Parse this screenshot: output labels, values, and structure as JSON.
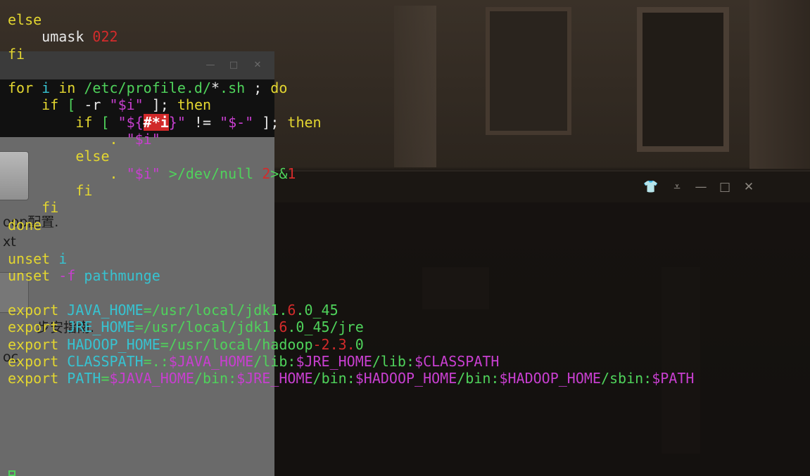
{
  "background_terminal": {
    "controls": {
      "shirt_glyph": "👕",
      "dropdown_glyph": "⩡",
      "minimize_glyph": "—",
      "maximize_glyph": "□",
      "close_glyph": "✕"
    }
  },
  "left_window": {
    "controls": {
      "minimize_glyph": "—",
      "maximize_glyph": "□",
      "close_glyph": "✕"
    },
    "texts": [
      "oop配置.",
      "xt",
      "步安指南.",
      "oc"
    ]
  },
  "terminal": {
    "colors": {
      "keyword": "#e3d630",
      "string": "#4fd35b",
      "variable": "#37c3d1",
      "special": "#c83fd0",
      "number": "#d32b2b"
    },
    "lines": [
      [
        {
          "t": "else",
          "c": "y"
        }
      ],
      [
        {
          "t": "    umask ",
          "c": "w"
        },
        {
          "t": "022",
          "c": "r"
        }
      ],
      [
        {
          "t": "fi",
          "c": "y"
        }
      ],
      [
        {
          "t": "",
          "c": "w"
        }
      ],
      [
        {
          "t": "for",
          "c": "y"
        },
        {
          "t": " i ",
          "c": "c"
        },
        {
          "t": "in",
          "c": "y"
        },
        {
          "t": " /etc/profile.d/",
          "c": "g"
        },
        {
          "t": "*",
          "c": "w"
        },
        {
          "t": ".sh",
          "c": "g"
        },
        {
          "t": " ; ",
          "c": "w"
        },
        {
          "t": "do",
          "c": "y"
        }
      ],
      [
        {
          "t": "    if",
          "c": "y"
        },
        {
          "t": " [ ",
          "c": "g"
        },
        {
          "t": "-r",
          "c": "w"
        },
        {
          "t": " \"",
          "c": "m"
        },
        {
          "t": "$i",
          "c": "m"
        },
        {
          "t": "\"",
          "c": "m"
        },
        {
          "t": " ]; ",
          "c": "w"
        },
        {
          "t": "then",
          "c": "y"
        }
      ],
      [
        {
          "t": "        if",
          "c": "y"
        },
        {
          "t": " [ ",
          "c": "g"
        },
        {
          "t": "\"${",
          "c": "m"
        },
        {
          "t": "#*i",
          "c": "hl"
        },
        {
          "t": "}\"",
          "c": "m"
        },
        {
          "t": " != ",
          "c": "w"
        },
        {
          "t": "\"$-\"",
          "c": "m"
        },
        {
          "t": " ]; ",
          "c": "w"
        },
        {
          "t": "then",
          "c": "y"
        }
      ],
      [
        {
          "t": "            . ",
          "c": "y"
        },
        {
          "t": "\"$i\"",
          "c": "m"
        }
      ],
      [
        {
          "t": "        else",
          "c": "y"
        }
      ],
      [
        {
          "t": "            . ",
          "c": "y"
        },
        {
          "t": "\"$i\"",
          "c": "m"
        },
        {
          "t": " >/dev/null ",
          "c": "g"
        },
        {
          "t": "2",
          "c": "r"
        },
        {
          "t": ">&",
          "c": "g"
        },
        {
          "t": "1",
          "c": "r"
        }
      ],
      [
        {
          "t": "        fi",
          "c": "y"
        }
      ],
      [
        {
          "t": "    fi",
          "c": "y"
        }
      ],
      [
        {
          "t": "done",
          "c": "y"
        }
      ],
      [
        {
          "t": "",
          "c": "w"
        }
      ],
      [
        {
          "t": "unset",
          "c": "y"
        },
        {
          "t": " i",
          "c": "c"
        }
      ],
      [
        {
          "t": "unset",
          "c": "y"
        },
        {
          "t": " -f",
          "c": "m"
        },
        {
          "t": " pathmunge",
          "c": "c"
        }
      ],
      [
        {
          "t": "",
          "c": "w"
        }
      ],
      [
        {
          "t": "export",
          "c": "y"
        },
        {
          "t": " JAVA_HOME",
          "c": "c"
        },
        {
          "t": "=/usr/local/jdk1.",
          "c": "g"
        },
        {
          "t": "6",
          "c": "r"
        },
        {
          "t": ".0_45",
          "c": "g"
        }
      ],
      [
        {
          "t": "export",
          "c": "y"
        },
        {
          "t": " JRE_HOME",
          "c": "c"
        },
        {
          "t": "=/usr/local/jdk1.",
          "c": "g"
        },
        {
          "t": "6",
          "c": "r"
        },
        {
          "t": ".0_45/jre",
          "c": "g"
        }
      ],
      [
        {
          "t": "export",
          "c": "y"
        },
        {
          "t": " HADOOP_HOME",
          "c": "c"
        },
        {
          "t": "=/usr/local/hadoop",
          "c": "g"
        },
        {
          "t": "-2.3.",
          "c": "r"
        },
        {
          "t": "0",
          "c": "g"
        }
      ],
      [
        {
          "t": "export",
          "c": "y"
        },
        {
          "t": " CLASSPATH",
          "c": "c"
        },
        {
          "t": "=.:",
          "c": "g"
        },
        {
          "t": "$JAVA_HOME",
          "c": "m"
        },
        {
          "t": "/lib:",
          "c": "g"
        },
        {
          "t": "$JRE_HOME",
          "c": "m"
        },
        {
          "t": "/lib:",
          "c": "g"
        },
        {
          "t": "$CLASSPATH",
          "c": "m"
        }
      ],
      [
        {
          "t": "export",
          "c": "y"
        },
        {
          "t": " PATH",
          "c": "c"
        },
        {
          "t": "=",
          "c": "g"
        },
        {
          "t": "$JAVA_HOME",
          "c": "m"
        },
        {
          "t": "/bin:",
          "c": "g"
        },
        {
          "t": "$JRE_HOME",
          "c": "m"
        },
        {
          "t": "/bin:",
          "c": "g"
        },
        {
          "t": "$HADOOP_HOME",
          "c": "m"
        },
        {
          "t": "/bin:",
          "c": "g"
        },
        {
          "t": "$HADOOP_HOME",
          "c": "m"
        },
        {
          "t": "/sbin:",
          "c": "g"
        },
        {
          "t": "$PATH",
          "c": "m"
        }
      ]
    ]
  }
}
